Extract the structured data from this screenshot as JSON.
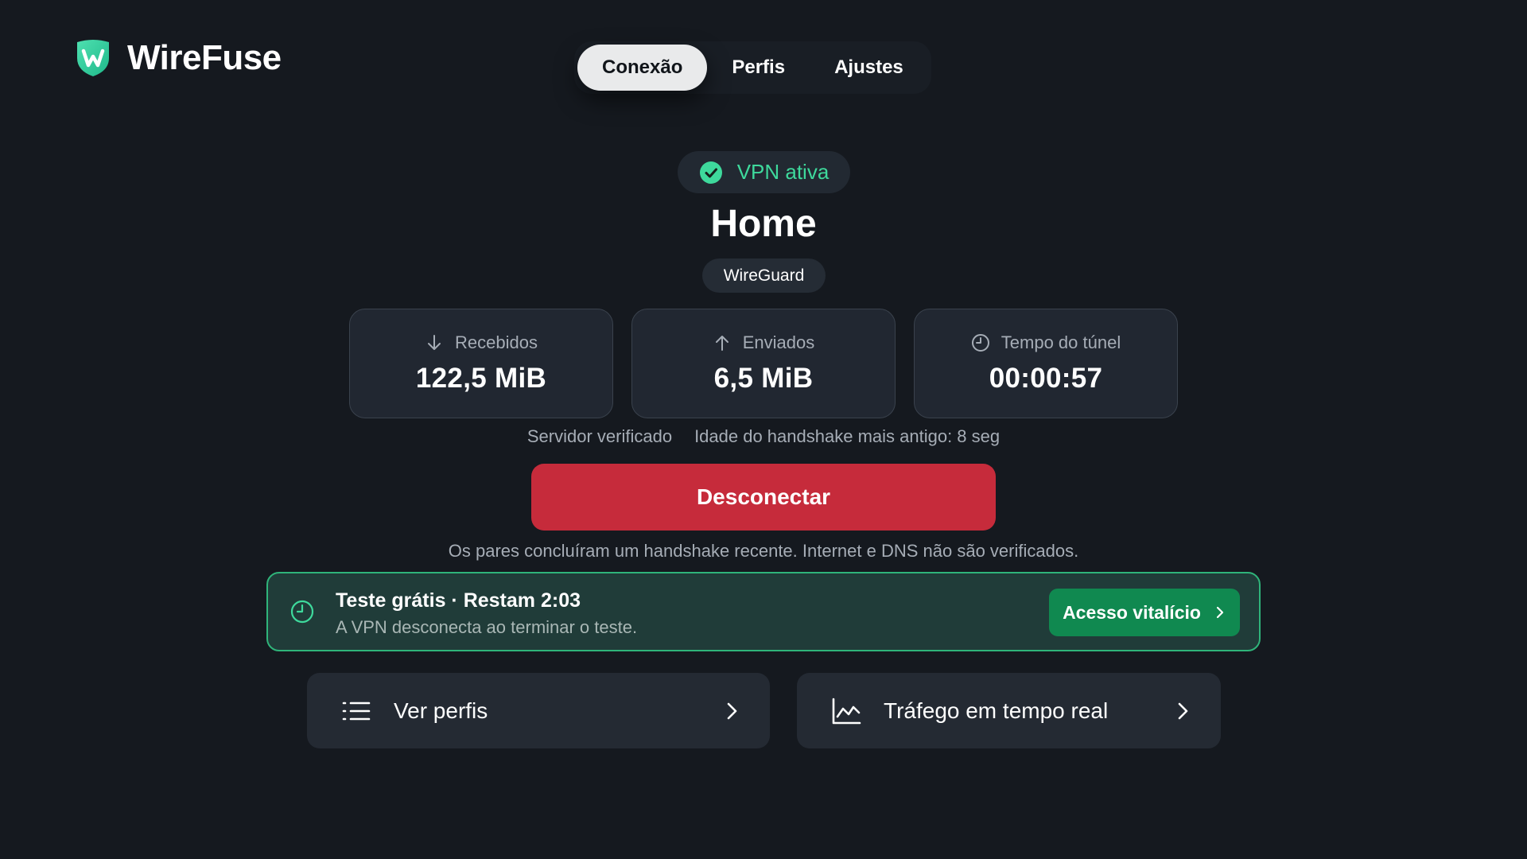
{
  "app": {
    "name": "WireFuse"
  },
  "tabs": [
    {
      "label": "Conexão",
      "active": true
    },
    {
      "label": "Perfis",
      "active": false
    },
    {
      "label": "Ajustes",
      "active": false
    }
  ],
  "status": {
    "text": "VPN ativa",
    "color": "#3ed99c"
  },
  "profile": {
    "name": "Home",
    "protocol": "WireGuard"
  },
  "stats": [
    {
      "icon": "arrow-down-icon",
      "label": "Recebidos",
      "value": "122,5 MiB"
    },
    {
      "icon": "arrow-up-icon",
      "label": "Enviados",
      "value": "6,5 MiB"
    },
    {
      "icon": "clock-icon",
      "label": "Tempo do túnel",
      "value": "00:00:57"
    }
  ],
  "meta": {
    "server": "Servidor verificado",
    "handshake": "Idade do handshake mais antigo: 8 seg"
  },
  "disconnect": {
    "label": "Desconectar",
    "color": "#c62b3b"
  },
  "note": "Os pares concluíram um handshake recente. Internet e DNS não são verificados.",
  "trial": {
    "title": "Teste grátis · Restam 2:03",
    "subtitle": "A VPN desconecta ao terminar o teste.",
    "button": "Acesso vitalício",
    "accent": "#2fb47a"
  },
  "nav_cards": [
    {
      "icon": "list-icon",
      "label": "Ver perfis"
    },
    {
      "icon": "line-chart-icon",
      "label": "Tráfego em tempo real"
    }
  ]
}
